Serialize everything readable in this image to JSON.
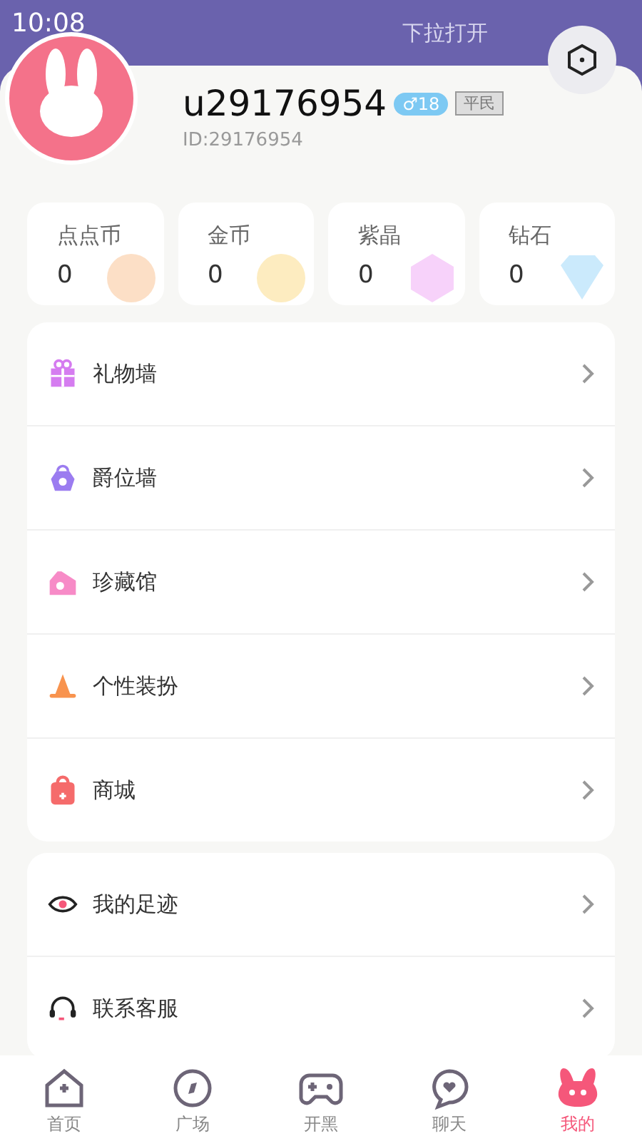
{
  "status_bar": {
    "time": "10:08",
    "hint": "下拉打开"
  },
  "profile": {
    "username": "u29176954",
    "gender_badge": "♂18",
    "rank_badge": "平民",
    "id": "ID:29176954"
  },
  "wallet": [
    {
      "kind": "dot",
      "label": "点点币",
      "value": "0"
    },
    {
      "kind": "gold",
      "label": "金币",
      "value": "0"
    },
    {
      "kind": "crystal",
      "label": "紫晶",
      "value": "0"
    },
    {
      "kind": "diamond",
      "label": "钻石",
      "value": "0"
    }
  ],
  "menu_groups": [
    [
      {
        "kind": "gift",
        "label": "礼物墙"
      },
      {
        "kind": "medal",
        "label": "爵位墙"
      },
      {
        "kind": "house",
        "label": "珍藏馆"
      },
      {
        "kind": "hat",
        "label": "个性装扮"
      },
      {
        "kind": "bag",
        "label": "商城"
      }
    ],
    [
      {
        "kind": "eye",
        "label": "我的足迹"
      },
      {
        "kind": "headset",
        "label": "联系客服"
      }
    ]
  ],
  "tabs": [
    {
      "kind": "home",
      "label": "首页",
      "selected": false
    },
    {
      "kind": "compass",
      "label": "广场",
      "selected": false
    },
    {
      "kind": "game",
      "label": "开黑",
      "selected": false
    },
    {
      "kind": "chat",
      "label": "聊天",
      "selected": false
    },
    {
      "kind": "bunny",
      "label": "我的",
      "selected": true
    }
  ]
}
